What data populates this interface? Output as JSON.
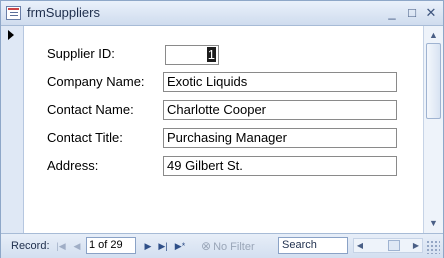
{
  "window": {
    "title": "frmSuppliers",
    "icons": {
      "app": "form-icon",
      "minimize": "minimize-icon",
      "maximize": "maximize-icon",
      "close": "close-icon"
    },
    "min_symbol": "_",
    "max_symbol": "□",
    "close_symbol": "✕"
  },
  "form": {
    "supplier_id": {
      "label": "Supplier ID:",
      "value": "1"
    },
    "company_name": {
      "label": "Company Name:",
      "value": "Exotic Liquids"
    },
    "contact_name": {
      "label": "Contact Name:",
      "value": "Charlotte Cooper"
    },
    "contact_title": {
      "label": "Contact Title:",
      "value": "Purchasing Manager"
    },
    "address": {
      "label": "Address:",
      "value": "49 Gilbert St."
    }
  },
  "navigation": {
    "record_label": "Record:",
    "record_position": "1 of 29",
    "first_symbol": "|◀",
    "prev_symbol": "◀",
    "next_symbol": "▶",
    "last_symbol": "▶|",
    "new_symbol": "▶*",
    "filter_label": "No Filter",
    "filter_symbol": "⊗",
    "search_placeholder": "Search"
  },
  "colors": {
    "accent": "#2f4f88",
    "titlebar": "#cfdcee",
    "selection": "#1d1d1d"
  }
}
